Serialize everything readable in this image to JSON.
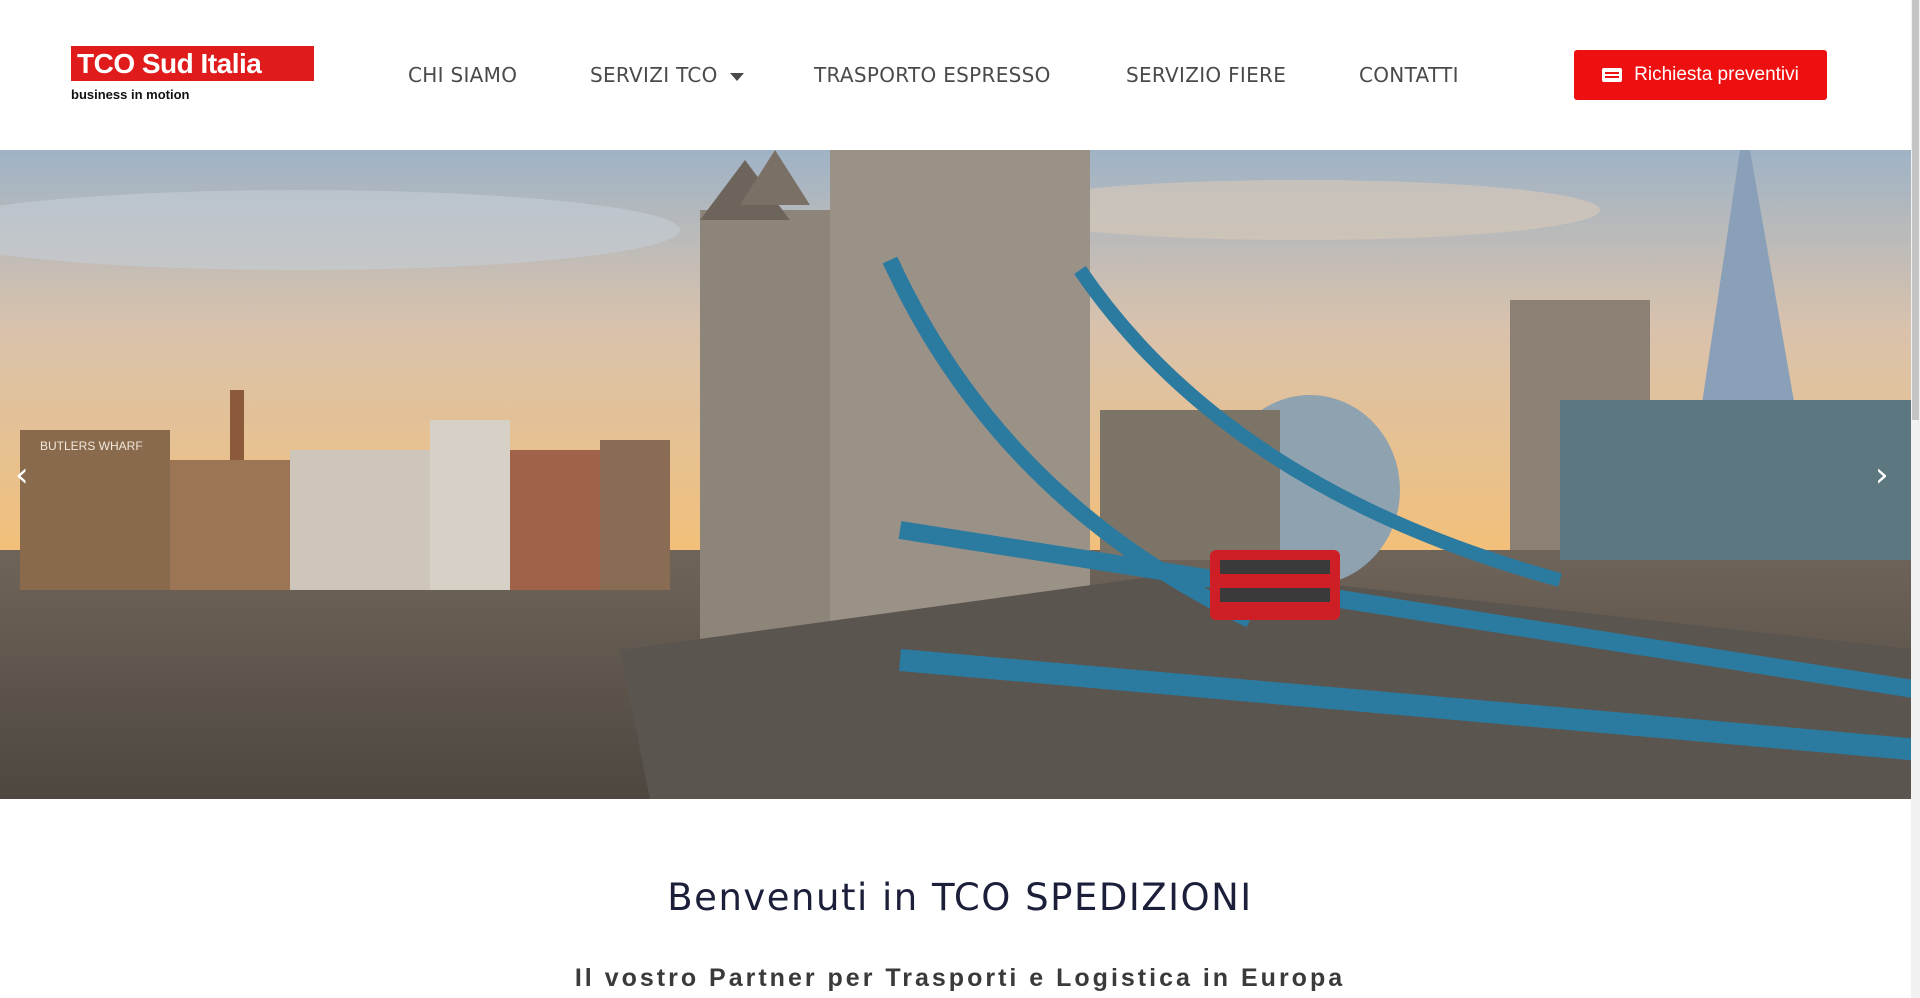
{
  "brand": {
    "name": "TCO Sud Italia",
    "tagline": "business in motion",
    "accent": "#e01b1b"
  },
  "nav": {
    "items": [
      {
        "label": "CHI SIAMO"
      },
      {
        "label": "SERVIZI TCO",
        "has_dropdown": true
      },
      {
        "label": "TRASPORTO ESPRESSO"
      },
      {
        "label": "SERVIZIO FIERE"
      },
      {
        "label": "CONTATTI"
      }
    ]
  },
  "cta": {
    "label": "Richiesta preventivi",
    "icon": "form-icon",
    "color": "#ee1010"
  },
  "hero": {
    "image": "Tower Bridge, London at sunset",
    "prev_icon": "chevron-left-icon",
    "next_icon": "chevron-right-icon",
    "signage": "BUTLERS WHARF"
  },
  "welcome": {
    "title": "Benvenuti in TCO SPEDIZIONI",
    "subtitle": "Il vostro Partner per Trasporti e Logistica in Europa"
  }
}
